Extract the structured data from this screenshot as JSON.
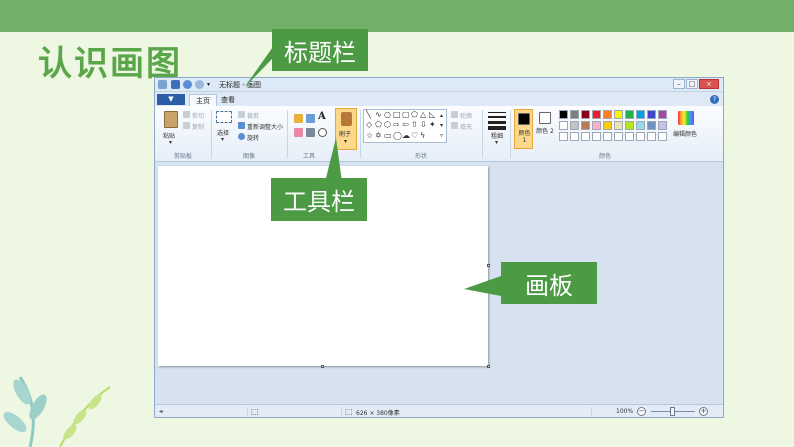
{
  "slide": {
    "title": "认识画图",
    "callouts": {
      "titlebar": "标题栏",
      "toolbar": "工具栏",
      "canvas": "画板"
    }
  },
  "paint": {
    "window_title": "无标题 - 画图",
    "file_menu": "▼",
    "window_buttons": [
      "–",
      "□",
      "×"
    ],
    "help_label": "?",
    "tabs": [
      "主页",
      "查看"
    ],
    "clipboard": {
      "paste": "粘贴",
      "cut": "剪切",
      "copy": "复制",
      "label": "剪贴板"
    },
    "image": {
      "select": "选择",
      "crop": "裁剪",
      "resize": "重新调整大小",
      "rotate": "旋转",
      "label": "图像"
    },
    "tools": {
      "label": "工具"
    },
    "brush": {
      "label": "刷子"
    },
    "shapes": {
      "outline": "轮廓",
      "fill": "填充",
      "label": "形状"
    },
    "size": {
      "label": "粗细"
    },
    "colors": {
      "color1": "颜色 1",
      "color2": "颜色 2",
      "edit": "编辑颜色",
      "label": "颜色",
      "row1": [
        "#000000",
        "#7f7f7f",
        "#880015",
        "#ed1c24",
        "#ff7f27",
        "#fff200",
        "#22b14c",
        "#00a2e8",
        "#3f48cc",
        "#a349a4"
      ],
      "row2": [
        "#ffffff",
        "#c3c3c3",
        "#b97a57",
        "#ffaec9",
        "#ffc90e",
        "#efe4b0",
        "#b5e61d",
        "#99d9ea",
        "#7092be",
        "#c8bfe7"
      ]
    },
    "status": {
      "dimensions": "626 × 380像素",
      "zoom": "100%"
    }
  },
  "accent": "#4d9a44"
}
